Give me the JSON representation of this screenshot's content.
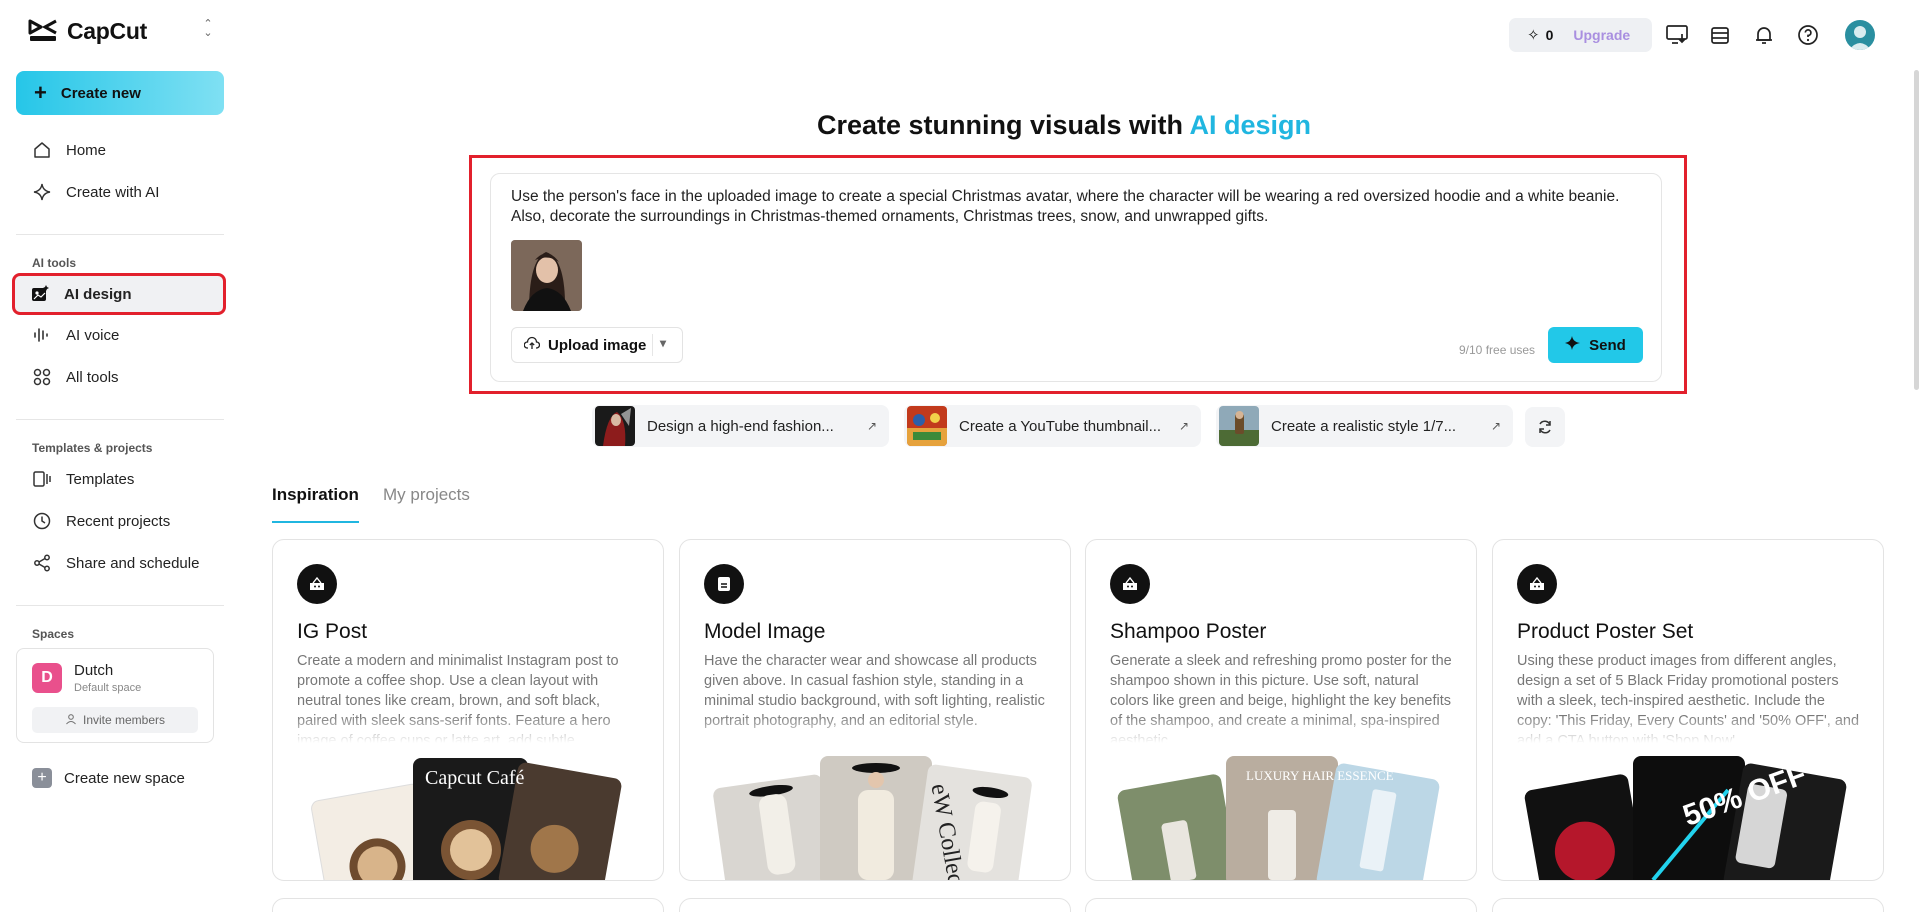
{
  "app": {
    "name": "CapCut"
  },
  "sidebar": {
    "create_new": "Create new",
    "main_items": [
      {
        "label": "Home",
        "icon": "home-icon"
      },
      {
        "label": "Create with AI",
        "icon": "sparkle-icon"
      }
    ],
    "ai_tools_label": "AI tools",
    "ai_tools": [
      {
        "label": "AI design",
        "icon": "ai-design-icon",
        "active": true
      },
      {
        "label": "AI voice",
        "icon": "waveform-icon"
      },
      {
        "label": "All tools",
        "icon": "grid-icon"
      }
    ],
    "templates_label": "Templates & projects",
    "templates_items": [
      {
        "label": "Templates",
        "icon": "templates-icon"
      },
      {
        "label": "Recent projects",
        "icon": "clock-icon"
      },
      {
        "label": "Share and schedule",
        "icon": "share-icon"
      }
    ],
    "spaces_label": "Spaces",
    "space": {
      "initial": "D",
      "name": "Dutch",
      "subtitle": "Default space",
      "invite": "Invite members"
    },
    "create_space": "Create new space"
  },
  "topbar": {
    "credits": "0",
    "upgrade": "Upgrade"
  },
  "hero": {
    "title_prefix": "Create stunning visuals with ",
    "title_accent": "AI design"
  },
  "prompt": {
    "text": "Use the person's face in the uploaded image to create a special Christmas avatar, where the character will be wearing a red oversized hoodie and a white beanie. Also, decorate the surroundings in Christmas-themed ornaments, Christmas trees, snow, and unwrapped gifts.",
    "upload_label": "Upload image",
    "free_uses": "9/10 free uses",
    "send_label": "Send"
  },
  "suggestions": [
    {
      "label": "Design a high-end fashion..."
    },
    {
      "label": "Create a YouTube thumbnail..."
    },
    {
      "label": "Create a realistic style 1/7..."
    }
  ],
  "tabs": {
    "inspiration": "Inspiration",
    "my_projects": "My projects"
  },
  "cards": [
    {
      "title": "IG Post",
      "description": "Create a modern and minimalist Instagram post to promote a coffee shop. Use a clean layout with neutral tones like cream, brown, and soft black, paired with sleek sans-serif fonts. Feature a hero image of coffee cups or latte art, add subtle",
      "art_text": "Capcut Café"
    },
    {
      "title": "Model Image",
      "description": "Have the character wear and showcase all products given above. In casual fashion style, standing in a minimal studio background, with soft lighting, realistic portrait photography, and an editorial style.",
      "art_text": "eW Collecti"
    },
    {
      "title": "Shampoo Poster",
      "description": "Generate a sleek and refreshing promo poster for the shampoo shown in this picture. Use soft, natural colors like green and beige, highlight the key benefits of the shampoo, and create a minimal, spa-inspired aesthetic.",
      "art_text": "LUXURY HAIR ESSENCE"
    },
    {
      "title": "Product Poster Set",
      "description": "Using these product images from different angles, design a set of 5 Black Friday promotional posters with a sleek, tech-inspired aesthetic. Include the copy: 'This Friday, Every Counts' and '50% OFF', and add a CTA button with 'Shop Now'.",
      "art_text": "50% OFF"
    }
  ],
  "colors": {
    "accent": "#20b6e0",
    "highlight_frame": "#e2202c",
    "send": "#22c8e8",
    "space_avatar": "#e9508c",
    "upgrade": "#a98fe0"
  }
}
